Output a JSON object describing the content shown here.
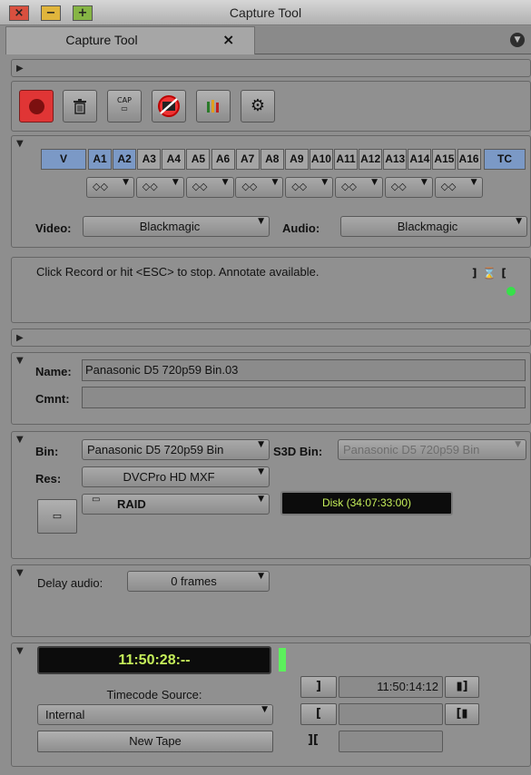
{
  "window": {
    "title": "Capture Tool",
    "close_glyph": "×",
    "min_glyph": "−",
    "max_glyph": "+"
  },
  "tab": {
    "title": "Capture Tool",
    "close_glyph": "×",
    "menu_glyph": "▼"
  },
  "toolbar": {
    "buttons": [
      {
        "name": "record-button",
        "icon": "record-icon"
      },
      {
        "name": "trash-button",
        "icon": "trash-icon"
      },
      {
        "name": "capture-mode-button",
        "icon": "cap-icon",
        "label": "CAP"
      },
      {
        "name": "no-capture-button",
        "icon": "prohibited-icon"
      },
      {
        "name": "audio-meter-button",
        "icon": "audio-meter-icon"
      },
      {
        "name": "settings-button",
        "icon": "gear-icon"
      }
    ]
  },
  "tracks": {
    "video": "V",
    "audio": [
      "A1",
      "A2",
      "A3",
      "A4",
      "A5",
      "A6",
      "A7",
      "A8",
      "A9",
      "A10",
      "A11",
      "A12",
      "A13",
      "A14",
      "A15",
      "A16"
    ],
    "active_audio": [
      "A1",
      "A2"
    ],
    "timecode": "TC",
    "channel_selectors": [
      "◇◇",
      "◇◇",
      "◇◇",
      "◇◇",
      "◇◇",
      "◇◇",
      "◇◇",
      "◇◇"
    ],
    "video_label": "Video:",
    "video_source": "Blackmagic",
    "audio_label": "Audio:",
    "audio_source": "Blackmagic"
  },
  "message": {
    "text": "Click Record or hit <ESC> to stop. Annotate available.",
    "status_color": "#37e04a"
  },
  "clip": {
    "name_label": "Name:",
    "name_value": "Panasonic D5 720p59 Bin.03",
    "comment_label": "Cmnt:",
    "comment_value": ""
  },
  "target": {
    "bin_label": "Bin:",
    "bin_value": "Panasonic D5 720p59 Bin",
    "s3d_label": "S3D Bin:",
    "s3d_value": "Panasonic D5 720p59 Bin",
    "res_label": "Res:",
    "res_value": "DVCPro HD  MXF",
    "drive_value": "RAID",
    "disk_readout": "Disk (34:07:33:00)"
  },
  "delay": {
    "label": "Delay audio:",
    "value": "0 frames"
  },
  "timecode": {
    "display": "11:50:28:--",
    "source_label": "Timecode Source:",
    "source_value": "Internal",
    "new_tape_label": "New Tape",
    "mark_in_value": "11:50:14:12",
    "mark_out_value": "",
    "duration_value": ""
  },
  "colors": {
    "record": "#e03535",
    "track_active": "#7b99c6",
    "lcd_text": "#c6ef5a",
    "meter_green": "#5cf05c"
  }
}
